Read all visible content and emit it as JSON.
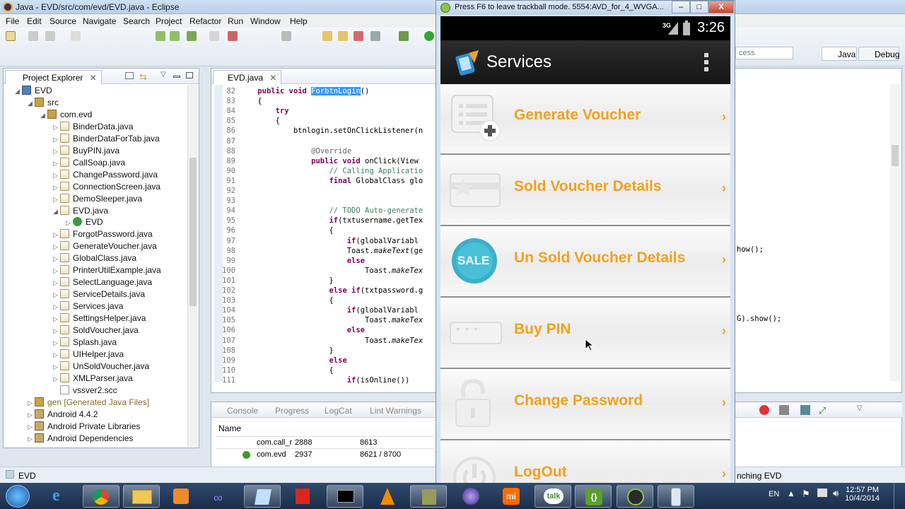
{
  "eclipse": {
    "title": "Java - EVD/src/com/evd/EVD.java - Eclipse",
    "menu": [
      "File",
      "Edit",
      "Source",
      "Navigate",
      "Search",
      "Project",
      "Refactor",
      "Run",
      "Window",
      "Help"
    ],
    "quick_access": "cess",
    "perspectives": [
      "Java",
      "Debug"
    ],
    "explorer": {
      "tab": "Project Explorer",
      "items": [
        {
          "label": "EVD",
          "depth": 0,
          "arrow": "◢",
          "kind": "pr"
        },
        {
          "label": "src",
          "depth": 1,
          "arrow": "◢",
          "kind": "pk"
        },
        {
          "label": "com.evd",
          "depth": 2,
          "arrow": "◢",
          "kind": "pk"
        },
        {
          "label": "BinderData.java",
          "depth": 3,
          "arrow": "▷",
          "kind": "jf"
        },
        {
          "label": "BinderDataForTab.java",
          "depth": 3,
          "arrow": "▷",
          "kind": "jf"
        },
        {
          "label": "BuyPIN.java",
          "depth": 3,
          "arrow": "▷",
          "kind": "jf"
        },
        {
          "label": "CallSoap.java",
          "depth": 3,
          "arrow": "▷",
          "kind": "jf"
        },
        {
          "label": "ChangePassword.java",
          "depth": 3,
          "arrow": "▷",
          "kind": "jf"
        },
        {
          "label": "ConnectionScreen.java",
          "depth": 3,
          "arrow": "▷",
          "kind": "jf"
        },
        {
          "label": "DemoSleeper.java",
          "depth": 3,
          "arrow": "▷",
          "kind": "jf"
        },
        {
          "label": "EVD.java",
          "depth": 3,
          "arrow": "◢",
          "kind": "jf"
        },
        {
          "label": "EVD",
          "depth": 4,
          "arrow": "▷",
          "kind": "cls"
        },
        {
          "label": "ForgotPassword.java",
          "depth": 3,
          "arrow": "▷",
          "kind": "jf"
        },
        {
          "label": "GenerateVoucher.java",
          "depth": 3,
          "arrow": "▷",
          "kind": "jf"
        },
        {
          "label": "GlobalClass.java",
          "depth": 3,
          "arrow": "▷",
          "kind": "jf"
        },
        {
          "label": "PrinterUtilExample.java",
          "depth": 3,
          "arrow": "▷",
          "kind": "jf"
        },
        {
          "label": "SelectLanguage.java",
          "depth": 3,
          "arrow": "▷",
          "kind": "jf"
        },
        {
          "label": "ServiceDetails.java",
          "depth": 3,
          "arrow": "▷",
          "kind": "jf"
        },
        {
          "label": "Services.java",
          "depth": 3,
          "arrow": "▷",
          "kind": "jf"
        },
        {
          "label": "SettingsHelper.java",
          "depth": 3,
          "arrow": "▷",
          "kind": "jf"
        },
        {
          "label": "SoldVoucher.java",
          "depth": 3,
          "arrow": "▷",
          "kind": "jf"
        },
        {
          "label": "Splash.java",
          "depth": 3,
          "arrow": "▷",
          "kind": "jf"
        },
        {
          "label": "UIHelper.java",
          "depth": 3,
          "arrow": "▷",
          "kind": "jf"
        },
        {
          "label": "UnSoldVoucher.java",
          "depth": 3,
          "arrow": "▷",
          "kind": "jf"
        },
        {
          "label": "XMLParser.java",
          "depth": 3,
          "arrow": "▷",
          "kind": "jf"
        },
        {
          "label": "vssver2.scc",
          "depth": 3,
          "arrow": "",
          "kind": "doc"
        },
        {
          "label": "gen [Generated Java Files]",
          "depth": 1,
          "arrow": "▷",
          "kind": "pk",
          "muted": true
        },
        {
          "label": "Android 4.4.2",
          "depth": 1,
          "arrow": "▷",
          "kind": "lib"
        },
        {
          "label": "Android Private Libraries",
          "depth": 1,
          "arrow": "▷",
          "kind": "lib"
        },
        {
          "label": "Android Dependencies",
          "depth": 1,
          "arrow": "▷",
          "kind": "lib"
        }
      ]
    },
    "editor_tab": "EVD.java",
    "code": [
      {
        "n": "82",
        "html": "    <span class='kw'>public void</span> <span class='hl'>ForbtnLogin</span>()"
      },
      {
        "n": "83",
        "html": "    {"
      },
      {
        "n": "84",
        "html": "        <span class='kw'>try</span>"
      },
      {
        "n": "85",
        "html": "        {"
      },
      {
        "n": "86",
        "html": "            btnlogin.setOnClickListener(n"
      },
      {
        "n": "87",
        "html": ""
      },
      {
        "n": "88",
        "html": "                <span class='an'>@Override</span>"
      },
      {
        "n": "89",
        "html": "                <span class='kw'>public void</span> onClick(View"
      },
      {
        "n": "90",
        "html": "                    <span class='cm'>// Calling Applicatio</span>"
      },
      {
        "n": "91",
        "html": "                    <span class='kw'>final</span> GlobalClass glo"
      },
      {
        "n": "92",
        "html": ""
      },
      {
        "n": "93",
        "html": ""
      },
      {
        "n": "94",
        "html": "                    <span class='cm'>// TODO Auto-generate</span>"
      },
      {
        "n": "95",
        "html": "                    <span class='kw'>if</span>(txtusername.getTex"
      },
      {
        "n": "96",
        "html": "                    {"
      },
      {
        "n": "97",
        "html": "                        <span class='kw'>if</span>(globalVariabl"
      },
      {
        "n": "98",
        "html": "                        Toast.<span class='it'>makeText</span>(ge"
      },
      {
        "n": "99",
        "html": "                        <span class='kw'>else</span>"
      },
      {
        "n": "100",
        "html": "                            Toast.<span class='it'>makeTex</span>"
      },
      {
        "n": "101",
        "html": "                    }"
      },
      {
        "n": "102",
        "html": "                    <span class='kw'>else if</span>(txtpassword.g"
      },
      {
        "n": "103",
        "html": "                    {"
      },
      {
        "n": "104",
        "html": "                        <span class='kw'>if</span>(globalVariabl"
      },
      {
        "n": "105",
        "html": "                            Toast.<span class='it'>makeTex</span>"
      },
      {
        "n": "106",
        "html": "                        <span class='kw'>else</span>"
      },
      {
        "n": "107",
        "html": "                            Toast.<span class='it'>makeTex</span>"
      },
      {
        "n": "108",
        "html": "                    }"
      },
      {
        "n": "109",
        "html": "                    <span class='kw'>else</span>"
      },
      {
        "n": "110",
        "html": "                    {"
      },
      {
        "n": "111",
        "html": "                        <span class='kw'>if</span>(isOnline())"
      }
    ],
    "code_right": [
      "how();",
      "G).show();"
    ],
    "console": {
      "tabs": [
        "Console",
        "Progress",
        "LogCat",
        "Lint Warnings"
      ],
      "header": "Name",
      "rows": [
        {
          "name": "com.call_r",
          "pid": "2888",
          "port": "8613"
        },
        {
          "name": "com.evd",
          "pid": "2937",
          "port": "8621 / 8700"
        }
      ]
    },
    "status_left": "EVD",
    "status_right": "nching EVD"
  },
  "emulator": {
    "title": "Press F6 to leave trackball mode. 5554:AVD_for_4_WVGA...",
    "minimize": "–",
    "maximize": "□",
    "close": "X",
    "network": "3G",
    "time": "3:26",
    "app_title": "Services",
    "items": [
      {
        "label": "Generate Voucher",
        "icon": "voucher-add-icon"
      },
      {
        "label": "Sold Voucher Details",
        "icon": "sold-card-icon"
      },
      {
        "label": "Un Sold Voucher Details",
        "icon": "sale-badge-icon"
      },
      {
        "label": "Buy PIN",
        "icon": "pin-card-icon"
      },
      {
        "label": "Change Password",
        "icon": "lock-icon"
      },
      {
        "label": "LogOut",
        "icon": "power-icon"
      }
    ],
    "chevron": "›",
    "sale_text": "SALE",
    "pin_text": "* * *"
  },
  "taskbar": {
    "lang": "EN",
    "time": "12:57 PM",
    "date": "10/4/2014"
  },
  "colors": {
    "accent": "#f0a21e",
    "eclipse_title": "#b9d0ea",
    "taskbar": "#1a2d48"
  }
}
